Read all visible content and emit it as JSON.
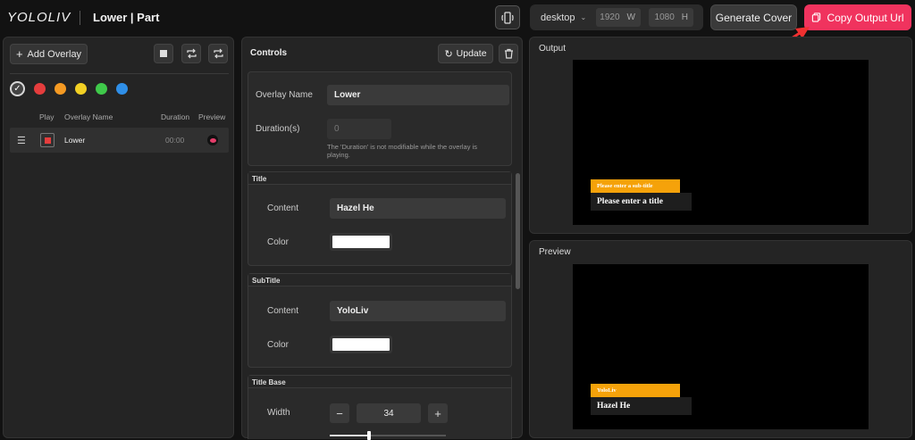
{
  "header": {
    "logo": "YOLOLIV",
    "project_title": "Lower | Part",
    "device": "desktop",
    "width_value": "1920",
    "width_unit": "W",
    "height_value": "1080",
    "height_unit": "H",
    "generate_cover_label": "Generate Cover",
    "copy_output_label": "Copy Output Url",
    "copy_button_color": "#f0335e"
  },
  "overlays": {
    "add_label": "Add Overlay",
    "colors": [
      "#e53d3d",
      "#f59a23",
      "#f2d024",
      "#3fc94a",
      "#2f8fe8"
    ],
    "columns": {
      "play": "Play",
      "name": "Overlay Name",
      "duration": "Duration",
      "preview": "Preview"
    },
    "rows": [
      {
        "name": "Lower",
        "duration": "00:00"
      }
    ]
  },
  "controls": {
    "title": "Controls",
    "update_label": "Update",
    "overlay_name_label": "Overlay Name",
    "overlay_name_value": "Lower",
    "duration_label": "Duration(s)",
    "duration_value": "0",
    "duration_note": "The 'Duration' is not modifiable while the overlay is playing.",
    "title_section": {
      "header": "Title",
      "content_label": "Content",
      "content_value": "Hazel He",
      "color_label": "Color"
    },
    "subtitle_section": {
      "header": "SubTitle",
      "content_label": "Content",
      "content_value": "YoloLiv",
      "color_label": "Color"
    },
    "title_base_section": {
      "header": "Title Base",
      "width_label": "Width",
      "width_value": "34",
      "width_fraction": 0.34
    }
  },
  "output": {
    "label": "Output",
    "subtitle": "Please enter a sub-title",
    "title": "Please enter a title",
    "subtitle_bg": "#f5a20a"
  },
  "preview": {
    "label": "Preview",
    "subtitle": "YoloLiv",
    "title": "Hazel He"
  }
}
